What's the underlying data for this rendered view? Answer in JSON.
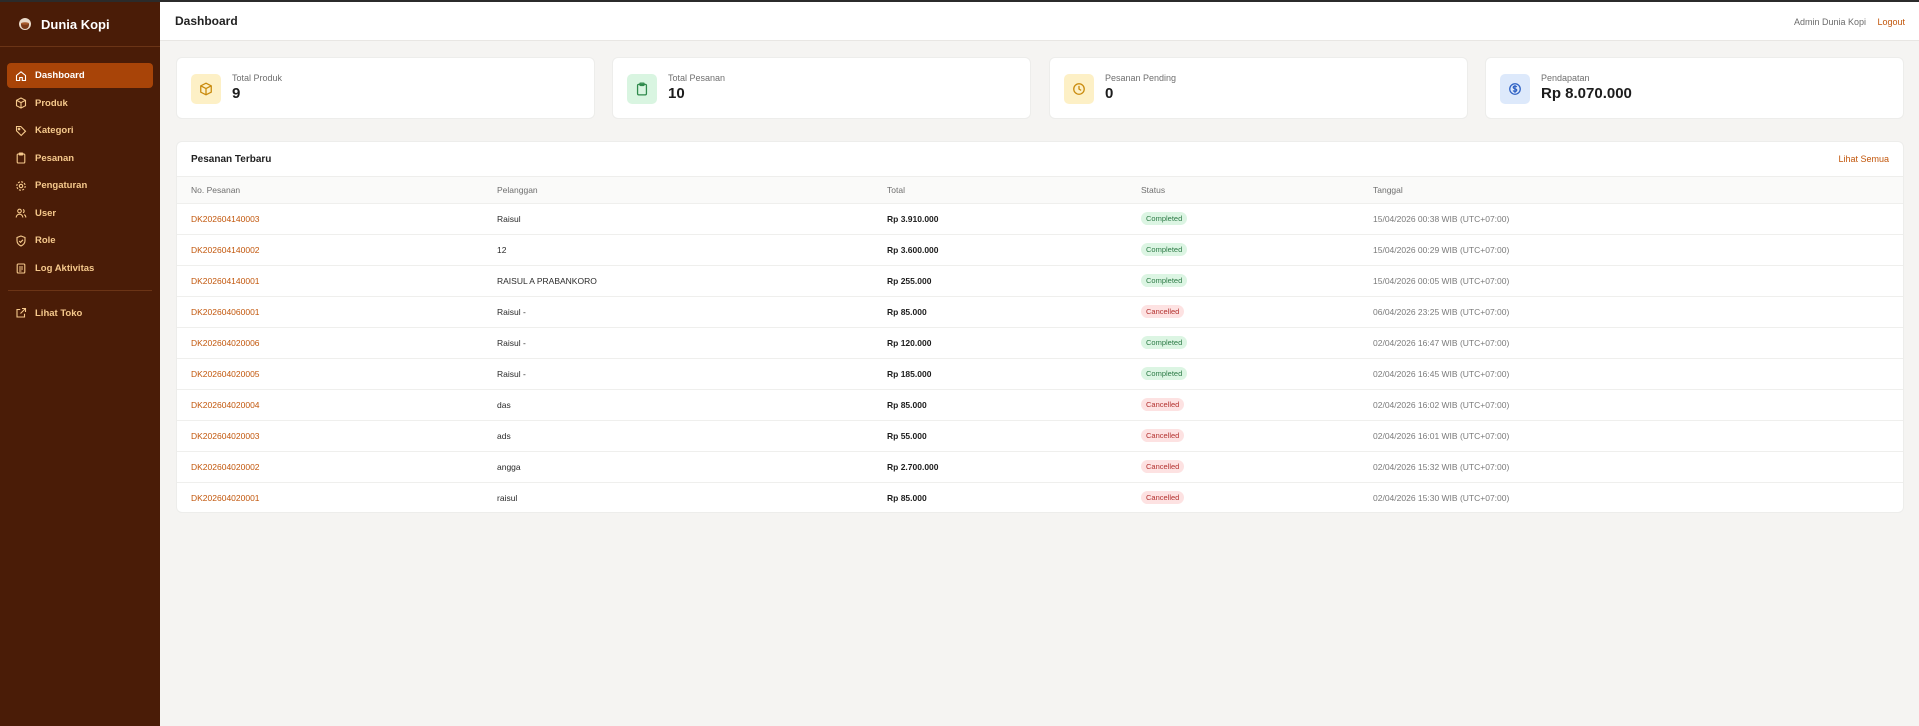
{
  "app": {
    "name": "Dunia Kopi"
  },
  "colors": {
    "sidebar_bg": "#4a1c07",
    "accent": "#c2570c",
    "active_nav": "#a84408"
  },
  "sidebar": {
    "items": [
      {
        "label": "Dashboard",
        "icon": "home-icon",
        "active": true
      },
      {
        "label": "Produk",
        "icon": "box-icon"
      },
      {
        "label": "Kategori",
        "icon": "tag-icon"
      },
      {
        "label": "Pesanan",
        "icon": "clipboard-icon"
      },
      {
        "label": "Pengaturan",
        "icon": "gear-icon"
      },
      {
        "label": "User",
        "icon": "users-icon"
      },
      {
        "label": "Role",
        "icon": "shield-check-icon"
      },
      {
        "label": "Log Aktivitas",
        "icon": "list-clipboard-icon"
      }
    ],
    "store_link": {
      "label": "Lihat Toko",
      "icon": "external-link-icon"
    }
  },
  "header": {
    "title": "Dashboard",
    "user": "Admin Dunia Kopi",
    "logout": "Logout"
  },
  "stats": [
    {
      "label": "Total Produk",
      "value": "9",
      "icon": "box-icon"
    },
    {
      "label": "Total Pesanan",
      "value": "10",
      "icon": "clipboard-icon"
    },
    {
      "label": "Pesanan Pending",
      "value": "0",
      "icon": "clock-icon"
    },
    {
      "label": "Pendapatan",
      "value": "Rp 8.070.000",
      "icon": "dollar-circle-icon"
    }
  ],
  "orders": {
    "title": "Pesanan Terbaru",
    "see_all": "Lihat Semua",
    "columns": [
      "No. Pesanan",
      "Pelanggan",
      "Total",
      "Status",
      "Tanggal"
    ],
    "rows": [
      {
        "id": "DK202604140003",
        "customer": "Raisul",
        "total": "Rp 3.910.000",
        "status": "Completed",
        "date": "15/04/2026 00:38 WIB (UTC+07:00)"
      },
      {
        "id": "DK202604140002",
        "customer": "12",
        "total": "Rp 3.600.000",
        "status": "Completed",
        "date": "15/04/2026 00:29 WIB (UTC+07:00)"
      },
      {
        "id": "DK202604140001",
        "customer": "RAISUL A PRABANKORO",
        "total": "Rp 255.000",
        "status": "Completed",
        "date": "15/04/2026 00:05 WIB (UTC+07:00)"
      },
      {
        "id": "DK202604060001",
        "customer": "Raisul -",
        "total": "Rp 85.000",
        "status": "Cancelled",
        "date": "06/04/2026 23:25 WIB (UTC+07:00)"
      },
      {
        "id": "DK202604020006",
        "customer": "Raisul -",
        "total": "Rp 120.000",
        "status": "Completed",
        "date": "02/04/2026 16:47 WIB (UTC+07:00)"
      },
      {
        "id": "DK202604020005",
        "customer": "Raisul -",
        "total": "Rp 185.000",
        "status": "Completed",
        "date": "02/04/2026 16:45 WIB (UTC+07:00)"
      },
      {
        "id": "DK202604020004",
        "customer": "das",
        "total": "Rp 85.000",
        "status": "Cancelled",
        "date": "02/04/2026 16:02 WIB (UTC+07:00)"
      },
      {
        "id": "DK202604020003",
        "customer": "ads",
        "total": "Rp 55.000",
        "status": "Cancelled",
        "date": "02/04/2026 16:01 WIB (UTC+07:00)"
      },
      {
        "id": "DK202604020002",
        "customer": "angga",
        "total": "Rp 2.700.000",
        "status": "Cancelled",
        "date": "02/04/2026 15:32 WIB (UTC+07:00)"
      },
      {
        "id": "DK202604020001",
        "customer": "raisul",
        "total": "Rp 85.000",
        "status": "Cancelled",
        "date": "02/04/2026 15:30 WIB (UTC+07:00)"
      }
    ]
  }
}
